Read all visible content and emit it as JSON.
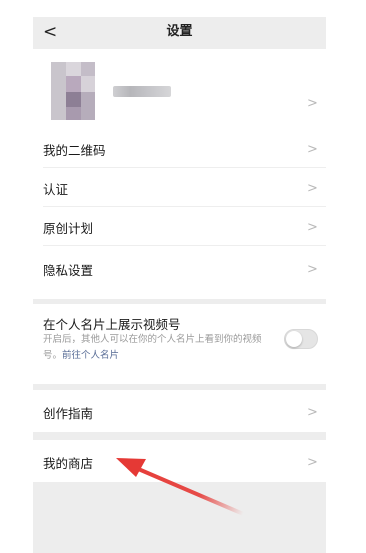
{
  "navbar": {
    "back_icon": "chevron-left-icon",
    "back_glyph": "<",
    "title": "设置"
  },
  "profile": {
    "name": "",
    "chevron_glyph": ">"
  },
  "menu": [
    {
      "label": "我的二维码"
    },
    {
      "label": "认证"
    },
    {
      "label": "原创计划"
    },
    {
      "label": "隐私设置"
    }
  ],
  "channels_toggle": {
    "title": "在个人名片上展示视频号",
    "description": "开启后，其他人可以在你的个人名片上看到你的视频号。",
    "link": "前往个人名片",
    "enabled": false
  },
  "guide": {
    "label": "创作指南"
  },
  "shop": {
    "label": "我的商店"
  },
  "chevron_glyph": ">",
  "colors": {
    "arrow": "#e53935",
    "link": "#576b95",
    "background": "#ededed"
  }
}
